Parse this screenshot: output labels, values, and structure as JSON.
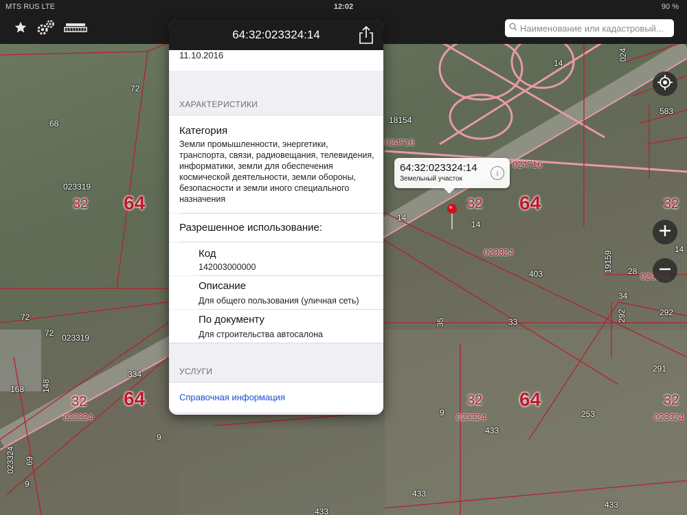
{
  "status": {
    "carrier": "MTS RUS  LTE",
    "time": "12:02",
    "battery": "90 %"
  },
  "toolbar": {
    "favorites_icon": "star-icon",
    "settings_icon": "gears-icon",
    "layers_icon": "layers-icon"
  },
  "search": {
    "placeholder": "Наименование или кадастровый..."
  },
  "popover": {
    "title": "64:32:023324:14",
    "date_value": "11.10.2016",
    "section_characteristics": "ХАРАКТЕРИСТИКИ",
    "category_label": "Категория",
    "category_value": "Земли промышленности, энергетики, транспорта, связи, радиовещания, телевидения, информатики, земли для обеспечения космической деятельности, земли обороны, безопасности и земли иного специального назначения",
    "permitted_use_label": "Разрешенное использование:",
    "code_label": "Код",
    "code_value": "142003000000",
    "description_label": "Описание",
    "description_value": "Для общего пользования (уличная сеть)",
    "by_document_label": "По документу",
    "by_document_value": "Для строительства автосалона",
    "section_services": "УСЛУГИ",
    "services_link": "Справочная информация"
  },
  "callout": {
    "title": "64:32:023324:14",
    "subtitle": "Земельный участок"
  },
  "map_labels": {
    "l72a": "72",
    "l68": "68",
    "l023319a": "023319",
    "l32a": "32",
    "l64a": "64",
    "l72b": "72",
    "l72c": "72",
    "l023319b": "023319",
    "l168": "168",
    "l148": "148",
    "l32b": "32",
    "l023324a": "023324",
    "l64b": "64",
    "l334": "334",
    "l69": "69",
    "l023324v": "023324",
    "l9a": "9",
    "l9b": "9",
    "l18154": "18154",
    "l024716a": "024716",
    "l024716b": "024716",
    "l14a": "14",
    "l14b": "14",
    "l32c": "32",
    "l14c": "14",
    "l64c": "64",
    "l023324b": "023324",
    "l403": "403",
    "l33a": "33",
    "l35": "35",
    "l32d": "32",
    "l023324c": "023324",
    "l64d": "64",
    "l433a": "433",
    "l9c": "9",
    "l253": "253",
    "l433b": "433",
    "l433c": "433",
    "l433d": "433",
    "l32e": "32",
    "l023324d": "023324",
    "l28": "28",
    "l023324e": "023324",
    "l34": "34",
    "l292a": "292",
    "l292b": "292",
    "l291": "291",
    "l19159": "19159",
    "l32f": "32",
    "l14d": "14",
    "l583": "583",
    "l024": "024"
  }
}
